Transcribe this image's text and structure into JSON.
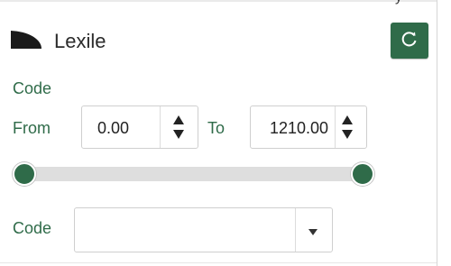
{
  "header": {
    "title": "Lexile",
    "top_fragment": "y"
  },
  "range": {
    "section_label": "Code",
    "from_label": "From",
    "to_label": "To",
    "from_value": "0.00",
    "to_value": "1210.00"
  },
  "code_filter": {
    "label": "Code",
    "selected": ""
  },
  "colors": {
    "accent": "#2f6b49"
  },
  "icons": {
    "facet": "quarter-circle-icon",
    "reset": "refresh-icon",
    "spinner": "up-down-arrows-icon",
    "dropdown": "caret-down-icon"
  }
}
